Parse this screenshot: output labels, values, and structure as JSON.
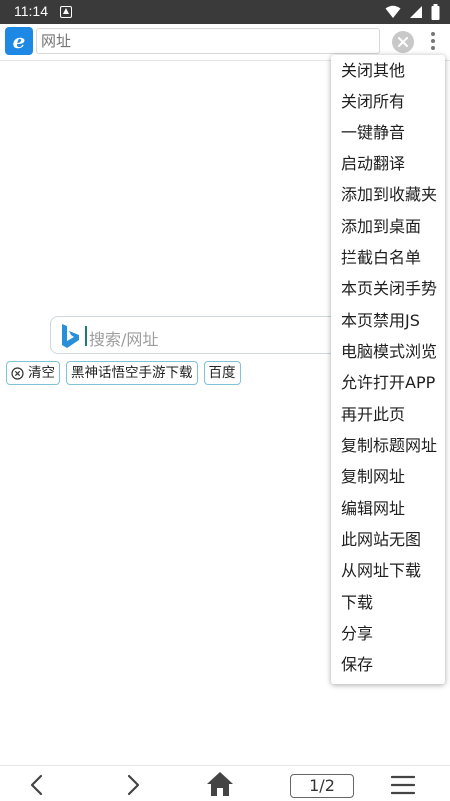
{
  "status_bar": {
    "time": "11:14"
  },
  "address_bar": {
    "placeholder": "网址",
    "logo_letter": "e"
  },
  "search": {
    "placeholder": "搜索/网址"
  },
  "history_chips": [
    {
      "label": "清空"
    },
    {
      "label": "黑神话悟空手游下载"
    },
    {
      "label": "百度"
    }
  ],
  "menu": {
    "items": [
      "关闭其他",
      "关闭所有",
      "一键静音",
      "启动翻译",
      "添加到收藏夹",
      "添加到桌面",
      "拦截白名单",
      "本页关闭手势",
      "本页禁用JS",
      "电脑模式浏览",
      "允许打开APP",
      "再开此页",
      "复制标题网址",
      "复制网址",
      "编辑网址",
      "此网站无图",
      "从网址下载",
      "下载",
      "分享",
      "保存"
    ]
  },
  "bottom_bar": {
    "page_indicator": "1/2"
  },
  "colors": {
    "status_bar": "#3a3a3a",
    "ie_blue": "#1e88e5",
    "chip_border": "#7ec4d6",
    "caret": "#1c7a6f"
  }
}
